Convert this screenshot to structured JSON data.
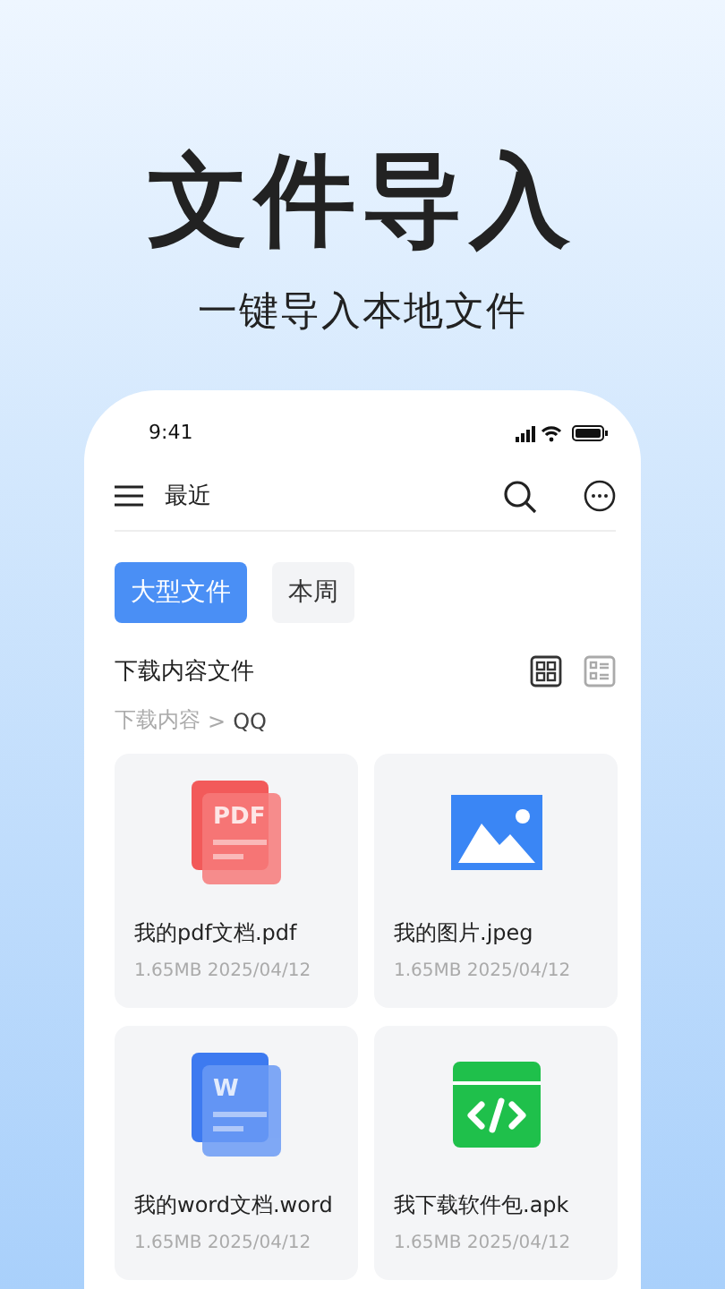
{
  "headline": {
    "title": "文件导入",
    "subtitle": "一键导入本地文件"
  },
  "status_bar": {
    "time": "9:41"
  },
  "toolbar": {
    "title": "最近"
  },
  "chips": [
    {
      "label": "大型文件",
      "selected": true
    },
    {
      "label": "本周",
      "selected": false
    }
  ],
  "section": {
    "title": "下载内容文件",
    "view_modes": [
      {
        "kind": "grid",
        "selected": true
      },
      {
        "kind": "list",
        "selected": false
      }
    ]
  },
  "breadcrumb": {
    "parent": "下载内容",
    "separator": ">",
    "current": "QQ"
  },
  "files": [
    {
      "kind": "pdf",
      "badge": "PDF",
      "name": "我的pdf文档.pdf",
      "meta": "1.65MB 2025/04/12"
    },
    {
      "kind": "image",
      "name": "我的图片.jpeg",
      "meta": "1.65MB 2025/04/12"
    },
    {
      "kind": "word",
      "badge": "W",
      "name": "我的word文档.word",
      "meta": "1.65MB 2025/04/12"
    },
    {
      "kind": "apk",
      "name": "我下载软件包.apk",
      "meta": "1.65MB 2025/04/12"
    }
  ]
}
